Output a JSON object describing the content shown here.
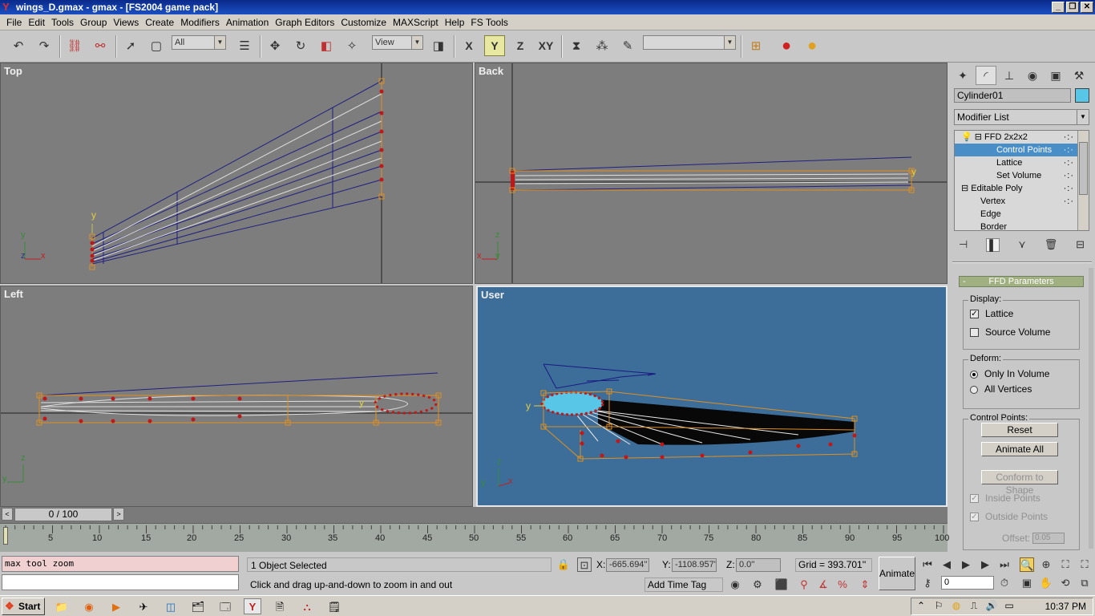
{
  "window": {
    "title": "wings_D.gmax - gmax - [FS2004 game pack]",
    "app_icon": "Y",
    "btn_min": "_",
    "btn_restore": "❐",
    "btn_close": "✕"
  },
  "menu": [
    "File",
    "Edit",
    "Tools",
    "Group",
    "Views",
    "Create",
    "Modifiers",
    "Animation",
    "Graph Editors",
    "Customize",
    "MAXScript",
    "Help",
    "FS Tools"
  ],
  "toolbar": {
    "selection_filter": "All",
    "ref_coord": "View",
    "axis_x": "X",
    "axis_y": "Y",
    "axis_z": "Z",
    "axis_xy": "XY",
    "named_sel": ""
  },
  "viewports": {
    "top": "Top",
    "back": "Back",
    "left": "Left",
    "user": "User"
  },
  "viewport_axes": {
    "x": "x",
    "y": "y",
    "z": "z"
  },
  "command_panel": {
    "object_name": "Cylinder01",
    "object_color": "#58c6e6",
    "modifier_list": "Modifier List",
    "stack": [
      {
        "label": "FFD 2x2x2",
        "indent": 0,
        "expander": "⊟",
        "bulb": true
      },
      {
        "label": "Control Points",
        "indent": 2,
        "selected": true
      },
      {
        "label": "Lattice",
        "indent": 2
      },
      {
        "label": "Set Volume",
        "indent": 2
      },
      {
        "label": "Editable Poly",
        "indent": 0,
        "expander": "⊟"
      },
      {
        "label": "Vertex",
        "indent": 1
      },
      {
        "label": "Edge",
        "indent": 1
      },
      {
        "label": "Border",
        "indent": 1
      }
    ],
    "rollout_title": "FFD Parameters",
    "rollout_toggle": "-",
    "display": {
      "title": "Display:",
      "lattice": "Lattice",
      "source_volume": "Source Volume"
    },
    "deform": {
      "title": "Deform:",
      "only_in_volume": "Only In Volume",
      "all_vertices": "All Vertices"
    },
    "control_points": {
      "title": "Control Points:",
      "reset": "Reset",
      "animate_all": "Animate All",
      "conform": "Conform to Shape",
      "inside": "Inside Points",
      "outside": "Outside Points",
      "offset_label": "Offset:",
      "offset_value": "0.05"
    }
  },
  "time_slider": {
    "label": "0 / 100",
    "prev": "<",
    "next": ">"
  },
  "trackbar_ticks": [
    "5",
    "10",
    "15",
    "20",
    "25",
    "30",
    "35",
    "40",
    "45",
    "50",
    "55",
    "60",
    "65",
    "70",
    "75",
    "80",
    "85",
    "90",
    "95",
    "100"
  ],
  "status": {
    "maxscript_line": "max tool zoom",
    "selection": "1 Object Selected",
    "prompt": "Click and drag up-and-down to zoom in and out",
    "x_label": "X:",
    "x": "-665.694''",
    "y_label": "Y:",
    "y": "-1108.957'",
    "z_label": "Z:",
    "z": "0.0''",
    "grid": "Grid = 393.701''",
    "animate": "Animate",
    "add_time_tag": "Add Time Tag",
    "frame": "0"
  },
  "taskbar": {
    "start": "Start",
    "clock": "10:37 PM"
  }
}
